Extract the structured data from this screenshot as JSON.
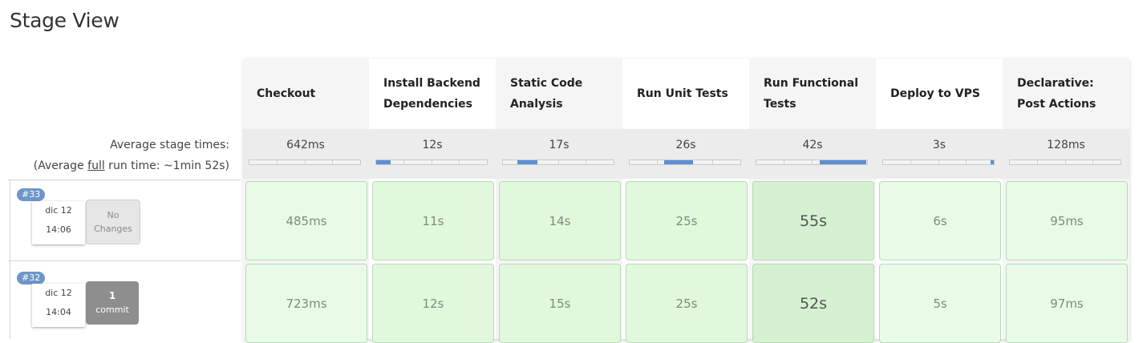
{
  "title": "Stage View",
  "summary": {
    "avg_stage_label": "Average stage times:",
    "avg_full_prefix": "(Average ",
    "avg_full_link": "full",
    "avg_full_suffix": " run time: ~1min 52s)"
  },
  "stages": [
    {
      "name": "Checkout",
      "avg": "642ms",
      "bar_fill": 0.0
    },
    {
      "name": "Install Backend Dependencies",
      "avg": "12s",
      "bar_fill": 0.13
    },
    {
      "name": "Static Code Analysis",
      "avg": "17s",
      "bar_fill": 0.18
    },
    {
      "name": "Run Unit Tests",
      "avg": "26s",
      "bar_fill": 0.26
    },
    {
      "name": "Run Functional Tests",
      "avg": "42s",
      "bar_fill": 0.42
    },
    {
      "name": "Deploy to VPS",
      "avg": "3s",
      "bar_fill": 0.03
    },
    {
      "name": "Declarative: Post Actions",
      "avg": "128ms",
      "bar_fill": 0.0
    }
  ],
  "builds": [
    {
      "id": "#33",
      "date": "dic 12",
      "time": "14:06",
      "changes_line1": "No",
      "changes_line2": "Changes",
      "durations": [
        "485ms",
        "11s",
        "14s",
        "25s",
        "55s",
        "6s",
        "95ms"
      ]
    },
    {
      "id": "#32",
      "date": "dic 12",
      "time": "14:04",
      "changes_line1": "1",
      "changes_line2": "commit",
      "durations": [
        "723ms",
        "12s",
        "15s",
        "25s",
        "52s",
        "5s",
        "97ms"
      ]
    }
  ],
  "colors": {
    "bar_fill": "#5b8fd6",
    "cell_success": "#e1f8dd",
    "badge": "#6d96c6"
  }
}
